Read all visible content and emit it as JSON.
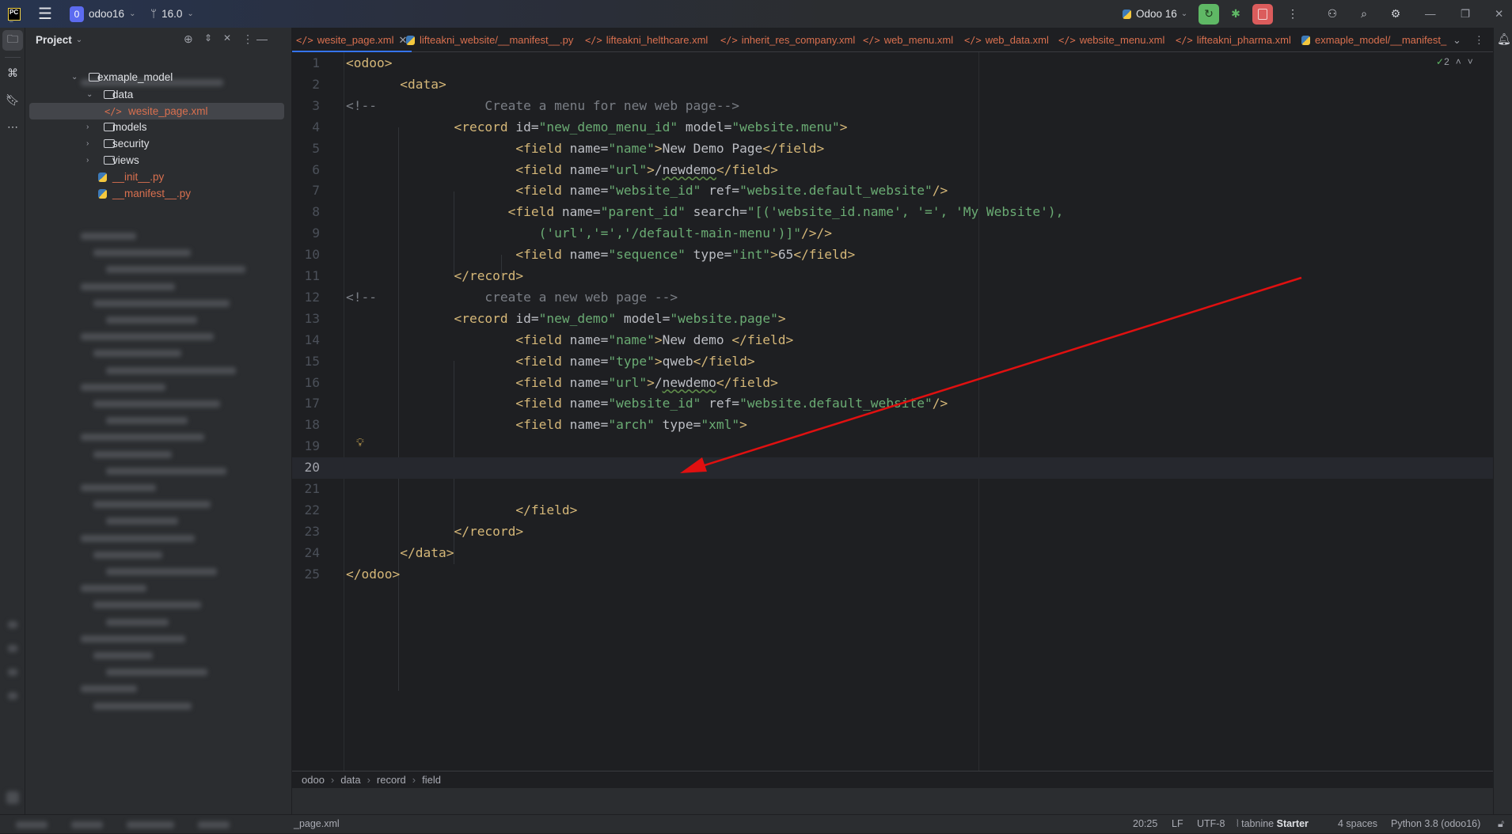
{
  "titlebar": {
    "project_badge": "0",
    "project_name": "odoo16",
    "branch": "16.0",
    "run_config": "Odoo 16",
    "icons": [
      "pycharm-logo",
      "hamburger-menu-icon",
      "branch-icon",
      "python-icon",
      "rerun-icon",
      "debug-icon",
      "stop-icon",
      "more-icon",
      "add-user-icon",
      "search-icon",
      "settings-icon",
      "minimize-icon",
      "restore-icon",
      "close-icon"
    ]
  },
  "project_panel": {
    "title": "Project",
    "tree": [
      {
        "label": "exmaple_model",
        "kind": "package",
        "expanded": true
      },
      {
        "label": "data",
        "kind": "folder",
        "expanded": true
      },
      {
        "label": "wesite_page.xml",
        "kind": "xml",
        "selected": true
      },
      {
        "label": "models",
        "kind": "package",
        "expanded": false
      },
      {
        "label": "security",
        "kind": "folder",
        "expanded": false
      },
      {
        "label": "views",
        "kind": "folder",
        "expanded": false
      },
      {
        "label": "__init__.py",
        "kind": "python"
      },
      {
        "label": "__manifest__.py",
        "kind": "python"
      }
    ]
  },
  "tabs": [
    {
      "label": "wesite_page.xml",
      "kind": "xml",
      "active": true
    },
    {
      "label": "lifteakni_website/__manifest__.py",
      "kind": "python"
    },
    {
      "label": "lifteakni_helthcare.xml",
      "kind": "xml"
    },
    {
      "label": "inherit_res_company.xml",
      "kind": "xml"
    },
    {
      "label": "web_menu.xml",
      "kind": "xml"
    },
    {
      "label": "web_data.xml",
      "kind": "xml"
    },
    {
      "label": "website_menu.xml",
      "kind": "xml"
    },
    {
      "label": "lifteakni_pharma.xml",
      "kind": "xml"
    },
    {
      "label": "exmaple_model/__manifest_",
      "kind": "python"
    }
  ],
  "editor": {
    "inspection_count": "2",
    "current_line": 20,
    "lines": [
      {
        "n": "1",
        "indent": 0,
        "tokens": [
          [
            "tag",
            "<odoo>"
          ]
        ]
      },
      {
        "n": "2",
        "indent": 7,
        "tokens": [
          [
            "tag",
            "<data>"
          ]
        ]
      },
      {
        "n": "3",
        "indent": 0,
        "tokens": [
          [
            "com",
            "<!--              Create a menu for new web page-->"
          ]
        ]
      },
      {
        "n": "4",
        "indent": 14,
        "tokens": [
          [
            "tag",
            "<record "
          ],
          [
            "attr",
            "id="
          ],
          [
            "val",
            "\"new_demo_menu_id\""
          ],
          [
            "attr",
            " model="
          ],
          [
            "val",
            "\"website.menu\""
          ],
          [
            "tag",
            ">"
          ]
        ]
      },
      {
        "n": "5",
        "indent": 22,
        "tokens": [
          [
            "tag",
            "<field "
          ],
          [
            "attr",
            "name="
          ],
          [
            "val",
            "\"name\""
          ],
          [
            "tag",
            ">"
          ],
          [
            "text",
            "New Demo Page"
          ],
          [
            "tag",
            "</field>"
          ]
        ]
      },
      {
        "n": "6",
        "indent": 22,
        "tokens": [
          [
            "tag",
            "<field "
          ],
          [
            "attr",
            "name="
          ],
          [
            "val",
            "\"url\""
          ],
          [
            "tag",
            ">"
          ],
          [
            "text",
            "/"
          ],
          [
            "typo",
            "newdemo"
          ],
          [
            "tag",
            "</field>"
          ]
        ]
      },
      {
        "n": "7",
        "indent": 22,
        "tokens": [
          [
            "tag",
            "<field "
          ],
          [
            "attr",
            "name="
          ],
          [
            "val",
            "\"website_id\""
          ],
          [
            "attr",
            " ref="
          ],
          [
            "val",
            "\"website.default_website\""
          ],
          [
            "tag",
            "/>"
          ]
        ]
      },
      {
        "n": "8",
        "indent": 21,
        "tokens": [
          [
            "tag",
            "<field "
          ],
          [
            "attr",
            "name="
          ],
          [
            "val",
            "\"parent_id\""
          ],
          [
            "attr",
            " search="
          ],
          [
            "val",
            "\"[('website_id.name', '=', 'My Website'),"
          ]
        ]
      },
      {
        "n": "9",
        "indent": 25,
        "tokens": [
          [
            "val",
            "('url','=','/default-main-menu')]\""
          ],
          [
            "tag",
            "/>/>"
          ]
        ]
      },
      {
        "n": "10",
        "indent": 22,
        "tokens": [
          [
            "tag",
            "<field "
          ],
          [
            "attr",
            "name="
          ],
          [
            "val",
            "\"sequence\""
          ],
          [
            "attr",
            " type="
          ],
          [
            "val",
            "\"int\""
          ],
          [
            "tag",
            ">"
          ],
          [
            "text",
            "65"
          ],
          [
            "tag",
            "</field>"
          ]
        ]
      },
      {
        "n": "11",
        "indent": 14,
        "tokens": [
          [
            "tag",
            "</record>"
          ]
        ]
      },
      {
        "n": "12",
        "indent": 0,
        "tokens": [
          [
            "com",
            "<!--              create a new web page -->"
          ]
        ]
      },
      {
        "n": "13",
        "indent": 14,
        "tokens": [
          [
            "tag",
            "<record "
          ],
          [
            "attr",
            "id="
          ],
          [
            "val",
            "\"new_demo\""
          ],
          [
            "attr",
            " model="
          ],
          [
            "val",
            "\"website.page\""
          ],
          [
            "tag",
            ">"
          ]
        ]
      },
      {
        "n": "14",
        "indent": 22,
        "tokens": [
          [
            "tag",
            "<field "
          ],
          [
            "attr",
            "name="
          ],
          [
            "val",
            "\"name\""
          ],
          [
            "tag",
            ">"
          ],
          [
            "text",
            "New demo "
          ],
          [
            "tag",
            "</field>"
          ]
        ]
      },
      {
        "n": "15",
        "indent": 22,
        "tokens": [
          [
            "tag",
            "<field "
          ],
          [
            "attr",
            "name="
          ],
          [
            "val",
            "\"type\""
          ],
          [
            "tag",
            ">"
          ],
          [
            "text",
            "qweb"
          ],
          [
            "tag",
            "</field>"
          ]
        ]
      },
      {
        "n": "16",
        "indent": 22,
        "tokens": [
          [
            "tag",
            "<field "
          ],
          [
            "attr",
            "name="
          ],
          [
            "val",
            "\"url\""
          ],
          [
            "tag",
            ">"
          ],
          [
            "text",
            "/"
          ],
          [
            "typo",
            "newdemo"
          ],
          [
            "tag",
            "</field>"
          ]
        ]
      },
      {
        "n": "17",
        "indent": 22,
        "tokens": [
          [
            "tag",
            "<field "
          ],
          [
            "attr",
            "name="
          ],
          [
            "val",
            "\"website_id\""
          ],
          [
            "attr",
            " ref="
          ],
          [
            "val",
            "\"website.default_website\""
          ],
          [
            "tag",
            "/>"
          ]
        ]
      },
      {
        "n": "18",
        "indent": 22,
        "tokens": [
          [
            "tag",
            "<field "
          ],
          [
            "attr",
            "name="
          ],
          [
            "val",
            "\"arch\""
          ],
          [
            "attr",
            " type="
          ],
          [
            "val",
            "\"xml\""
          ],
          [
            "tag",
            ">"
          ]
        ]
      },
      {
        "n": "19",
        "indent": 0,
        "tokens": []
      },
      {
        "n": "20",
        "indent": 0,
        "tokens": []
      },
      {
        "n": "21",
        "indent": 0,
        "tokens": []
      },
      {
        "n": "22",
        "indent": 22,
        "tokens": [
          [
            "tag",
            "</field>"
          ]
        ]
      },
      {
        "n": "23",
        "indent": 14,
        "tokens": [
          [
            "tag",
            "</record>"
          ]
        ]
      },
      {
        "n": "24",
        "indent": 7,
        "tokens": [
          [
            "tag",
            "</data>"
          ]
        ]
      },
      {
        "n": "25",
        "indent": 0,
        "tokens": [
          [
            "tag",
            "</odoo>"
          ]
        ]
      }
    ],
    "annotation_arrow_color": "#E01010"
  },
  "breadcrumb": [
    "odoo",
    "data",
    "record",
    "field"
  ],
  "statusbar": {
    "left_path": "_page.xml",
    "position": "20:25",
    "line_sep": "LF",
    "encoding": "UTF-8",
    "tabnine": "tabnine",
    "tabnine_plan": "Starter",
    "indent": "4 spaces",
    "interpreter": "Python 3.8 (odoo16)"
  },
  "colors": {
    "accent": "#3574F0",
    "file_xml": "#D9704F",
    "run_green": "#5FB865",
    "stop_red": "#DB5C5C"
  }
}
